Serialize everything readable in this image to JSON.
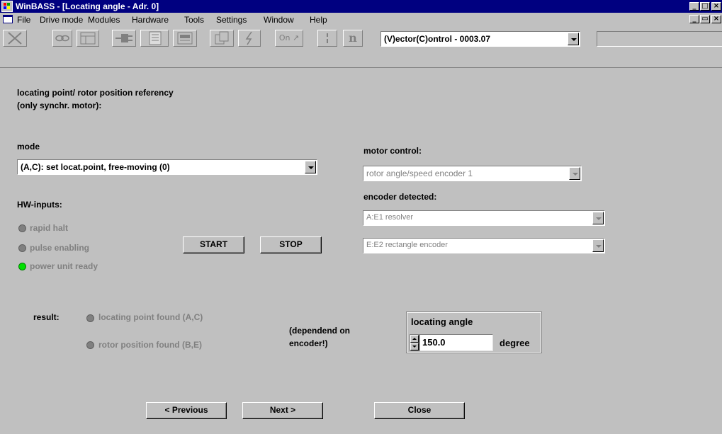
{
  "window": {
    "title": "WinBASS - [Locating angle - Adr. 0]",
    "buttons": {
      "minimize": "_",
      "maximize": "□",
      "close": "×"
    }
  },
  "menu": {
    "items": [
      "File",
      "Drive mode",
      "Modules",
      "Hardware",
      "Tools",
      "Settings",
      "Window",
      "Help"
    ],
    "mdi_buttons": {
      "minimize": "_",
      "restore": "▭",
      "close": "×"
    }
  },
  "toolbar": {
    "icons": [
      "cross-icon",
      "link-icon",
      "module-icon",
      "plug-icon",
      "doc-stack-icon",
      "terminal-icon",
      "copy-icon",
      "lightning-icon",
      "on-icon",
      "separator-icon",
      "n-icon"
    ],
    "on_label": "On",
    "n_label": "n",
    "control_combo": "(V)ector(C)ontrol - 0003.07"
  },
  "heading": {
    "line1": "locating point/ rotor position referency",
    "line2": "(only synchr. motor):"
  },
  "mode": {
    "label": "mode",
    "selected": "(A,C): set locat.point, free-moving (0)"
  },
  "motor_control": {
    "label": "motor control:",
    "selected": "rotor angle/speed encoder 1"
  },
  "encoder_detected": {
    "label": "encoder detected:",
    "encoder_a": "A:E1 resolver",
    "encoder_e": "E:E2 rectangle encoder"
  },
  "hw_inputs": {
    "label": "HW-inputs:",
    "items": [
      {
        "label": "rapid halt",
        "state": "off"
      },
      {
        "label": "pulse enabling",
        "state": "off"
      },
      {
        "label": "power unit ready",
        "state": "on"
      }
    ]
  },
  "actions": {
    "start": "START",
    "stop": "STOP"
  },
  "result": {
    "label": "result:",
    "locating_point": "locating point found (A,C)",
    "rotor_position": "rotor position found (B,E)",
    "note_line1": "(dependend on",
    "note_line2": "encoder!)"
  },
  "locating_angle": {
    "label": "locating angle",
    "value": "150.0",
    "unit": "degree"
  },
  "nav": {
    "previous": "< Previous",
    "next": "Next >",
    "close": "Close"
  },
  "colors": {
    "titlebar": "#000080",
    "face": "#c0c0c0",
    "led_on": "#00e000",
    "led_off": "#808080"
  }
}
